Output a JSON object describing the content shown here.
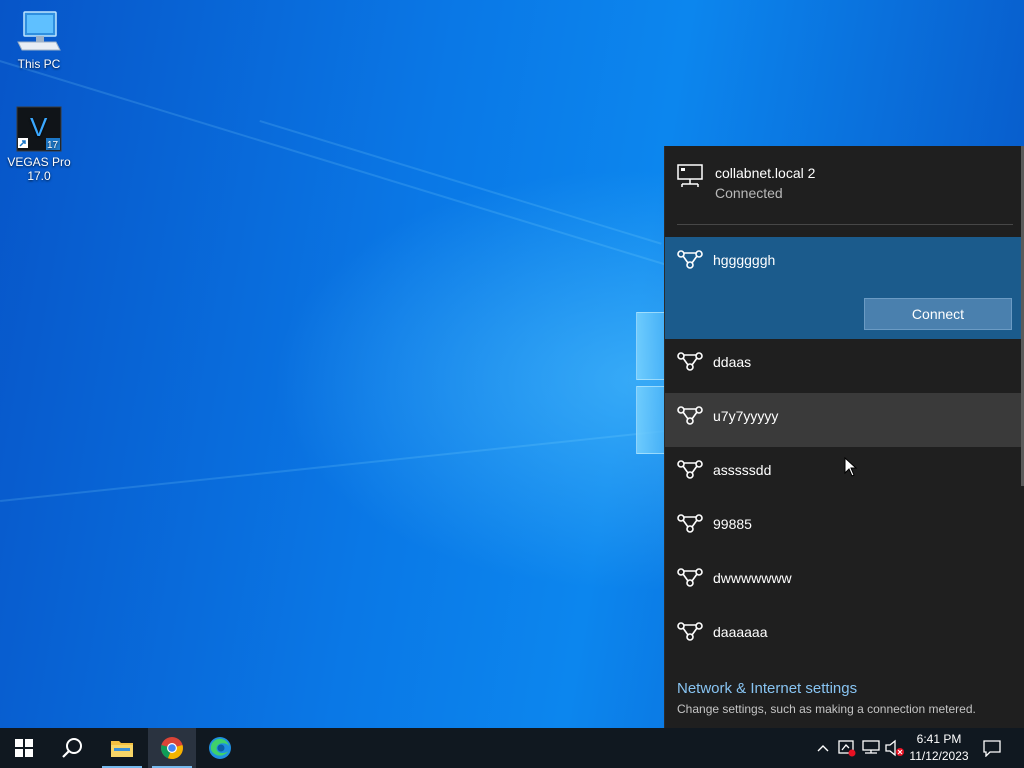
{
  "desktop": {
    "icons": [
      {
        "label": "This PC"
      },
      {
        "label": "VEGAS Pro 17.0"
      }
    ]
  },
  "network_flyout": {
    "wired": {
      "name": "collabnet.local 2",
      "status": "Connected"
    },
    "networks": [
      {
        "name": "hggggggh",
        "state": "selected",
        "action_label": "Connect"
      },
      {
        "name": "ddaas"
      },
      {
        "name": "u7y7yyyyy",
        "state": "hover"
      },
      {
        "name": "asssssdd"
      },
      {
        "name": "99885"
      },
      {
        "name": "dwwwwwww"
      },
      {
        "name": "daaaaaa"
      }
    ],
    "settings_link": "Network & Internet settings",
    "settings_description": "Change settings, such as making a connection metered."
  },
  "taskbar": {
    "apps": [
      "start-icon",
      "search-icon",
      "file-explorer-icon",
      "chrome-icon",
      "edge-icon"
    ],
    "tray": [
      "chevron-up-icon",
      "security-icon",
      "network-icon",
      "volume-muted-icon",
      "notification-icon"
    ],
    "clock": {
      "time": "6:41 PM",
      "date": "11/12/2023"
    }
  },
  "colors": {
    "flyout_bg": "#1f1f1f",
    "selected_bg": "#1b5b8c",
    "hover_bg": "#3a3a3a",
    "link": "#88c4f2",
    "taskbar_bg": "#101820"
  }
}
